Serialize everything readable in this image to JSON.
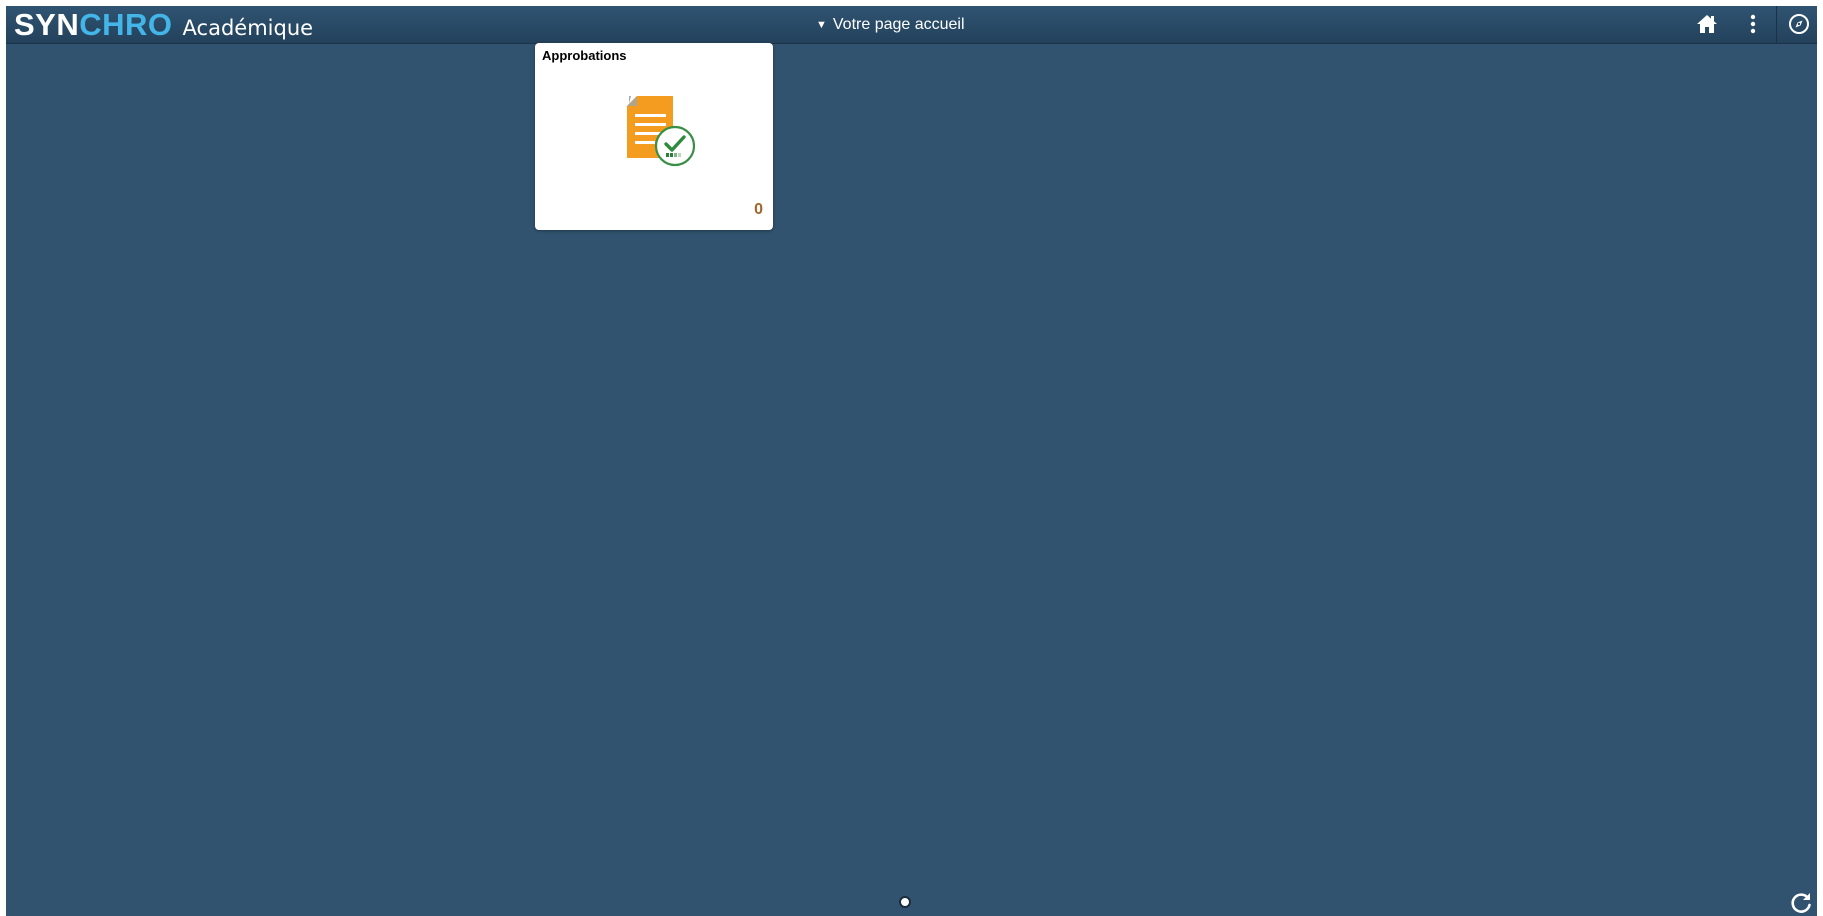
{
  "header": {
    "brand_main_prefix": "SYN",
    "brand_main_accent": "CHRO",
    "brand_sub": "Académique",
    "page_selector_label": "Votre page accueil",
    "icons": [
      "home-icon",
      "more-options-icon",
      "navigator-icon"
    ],
    "accent_color": "#43b5e8"
  },
  "tiles": [
    {
      "title": "Approbations",
      "count": "0",
      "icon": "approvals-document-check-icon"
    }
  ],
  "footer": {
    "icons": [
      "page-indicator-dot",
      "refresh-icon"
    ]
  },
  "colors": {
    "background": "#31536f",
    "tile_count": "#a0662c",
    "document_orange": "#f39c1f",
    "check_green": "#2e8b3e"
  }
}
